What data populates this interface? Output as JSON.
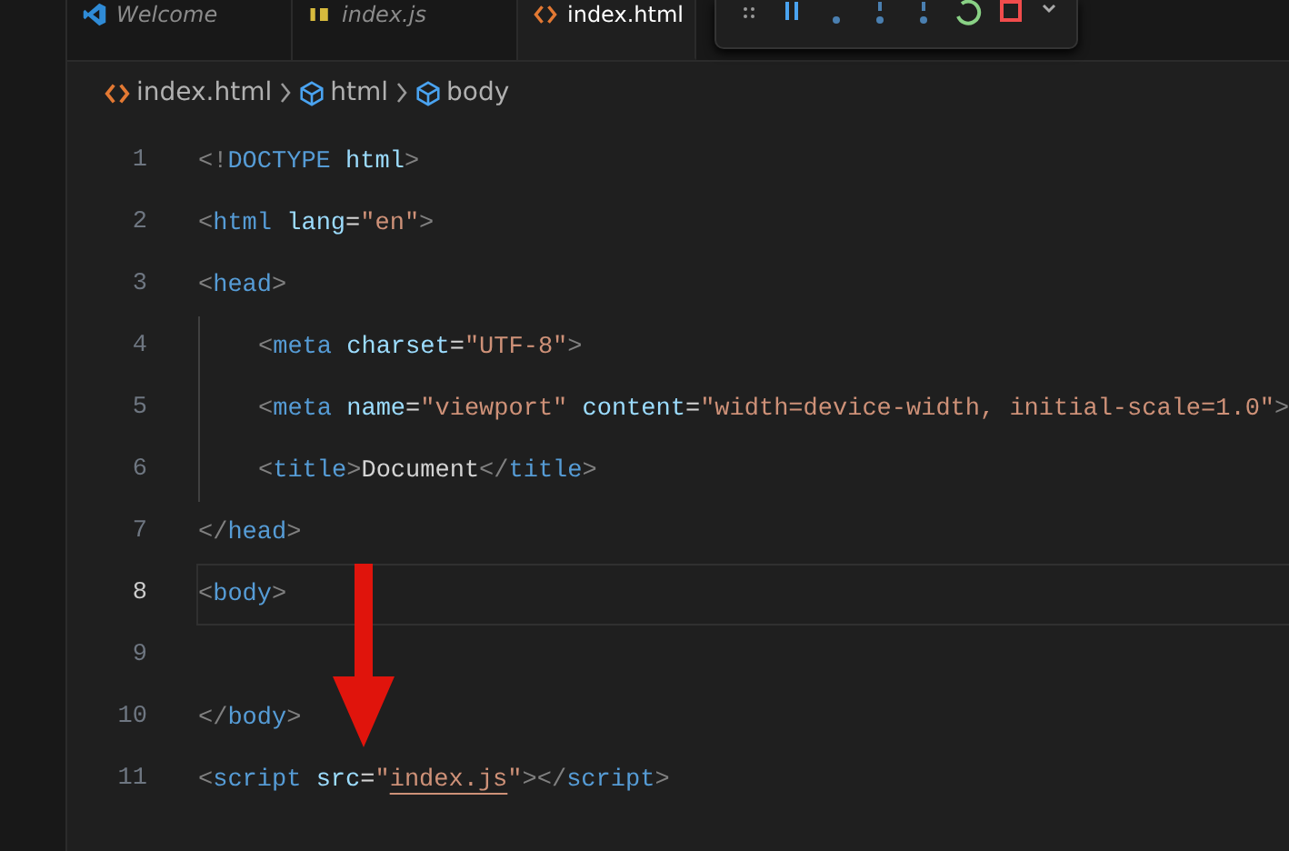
{
  "tabs": [
    {
      "label": "Welcome",
      "kind": "welcome",
      "selected": false
    },
    {
      "label": "index.js",
      "kind": "js",
      "selected": false
    },
    {
      "label": "index.html",
      "kind": "html",
      "selected": true
    }
  ],
  "breadcrumb": [
    {
      "label": "index.html",
      "kind": "file"
    },
    {
      "label": "html",
      "kind": "element"
    },
    {
      "label": "body",
      "kind": "element"
    }
  ],
  "editor": {
    "lines": [
      {
        "number": "1",
        "active": false,
        "indented": false,
        "tokens": [
          {
            "t": "<!",
            "kind": "punct"
          },
          {
            "t": "DOCTYPE",
            "kind": "tag"
          },
          {
            "t": " html",
            "kind": "attr"
          },
          {
            "t": ">",
            "kind": "punct"
          }
        ]
      },
      {
        "number": "2",
        "active": false,
        "indented": false,
        "tokens": [
          {
            "t": "<",
            "kind": "punct"
          },
          {
            "t": "html",
            "kind": "tag"
          },
          {
            "t": " lang",
            "kind": "attr"
          },
          {
            "t": "=",
            "kind": "text"
          },
          {
            "t": "\"en\"",
            "kind": "string"
          },
          {
            "t": ">",
            "kind": "punct"
          }
        ]
      },
      {
        "number": "3",
        "active": false,
        "indented": false,
        "tokens": [
          {
            "t": "<",
            "kind": "punct"
          },
          {
            "t": "head",
            "kind": "tag"
          },
          {
            "t": ">",
            "kind": "punct"
          }
        ]
      },
      {
        "number": "4",
        "active": false,
        "indented": true,
        "tokens": [
          {
            "t": "<",
            "kind": "punct"
          },
          {
            "t": "meta",
            "kind": "tag"
          },
          {
            "t": " charset",
            "kind": "attr"
          },
          {
            "t": "=",
            "kind": "text"
          },
          {
            "t": "\"UTF-8\"",
            "kind": "string"
          },
          {
            "t": ">",
            "kind": "punct"
          }
        ]
      },
      {
        "number": "5",
        "active": false,
        "indented": true,
        "tokens": [
          {
            "t": "<",
            "kind": "punct"
          },
          {
            "t": "meta",
            "kind": "tag"
          },
          {
            "t": " name",
            "kind": "attr"
          },
          {
            "t": "=",
            "kind": "text"
          },
          {
            "t": "\"viewport\"",
            "kind": "string"
          },
          {
            "t": " content",
            "kind": "attr"
          },
          {
            "t": "=",
            "kind": "text"
          },
          {
            "t": "\"width=device-width, initial-scale=1.0\"",
            "kind": "string"
          },
          {
            "t": ">",
            "kind": "punct"
          }
        ]
      },
      {
        "number": "6",
        "active": false,
        "indented": true,
        "tokens": [
          {
            "t": "<",
            "kind": "punct"
          },
          {
            "t": "title",
            "kind": "tag"
          },
          {
            "t": ">",
            "kind": "punct"
          },
          {
            "t": "Document",
            "kind": "text"
          },
          {
            "t": "</",
            "kind": "punct"
          },
          {
            "t": "title",
            "kind": "tag"
          },
          {
            "t": ">",
            "kind": "punct"
          }
        ]
      },
      {
        "number": "7",
        "active": false,
        "indented": false,
        "tokens": [
          {
            "t": "</",
            "kind": "punct"
          },
          {
            "t": "head",
            "kind": "tag"
          },
          {
            "t": ">",
            "kind": "punct"
          }
        ]
      },
      {
        "number": "8",
        "active": true,
        "indented": false,
        "tokens": [
          {
            "t": "<",
            "kind": "punct"
          },
          {
            "t": "body",
            "kind": "tag"
          },
          {
            "t": ">",
            "kind": "punct"
          }
        ]
      },
      {
        "number": "9",
        "active": false,
        "indented": false
      },
      {
        "number": "10",
        "active": false,
        "indented": false,
        "tokens": [
          {
            "t": "</",
            "kind": "punct"
          },
          {
            "t": "body",
            "kind": "tag"
          },
          {
            "t": ">",
            "kind": "punct"
          }
        ]
      },
      {
        "number": "11",
        "active": false,
        "indented": false,
        "tokens": [
          {
            "t": "<",
            "kind": "punct"
          },
          {
            "t": "script",
            "kind": "tag"
          },
          {
            "t": " src",
            "kind": "attr"
          },
          {
            "t": "=",
            "kind": "text"
          },
          {
            "t": "\"",
            "kind": "string"
          },
          {
            "t": "index.js",
            "kind": "link"
          },
          {
            "t": "\"",
            "kind": "string"
          },
          {
            "t": "></",
            "kind": "punct"
          },
          {
            "t": "script",
            "kind": "tag"
          },
          {
            "t": ">",
            "kind": "punct"
          }
        ]
      }
    ]
  }
}
